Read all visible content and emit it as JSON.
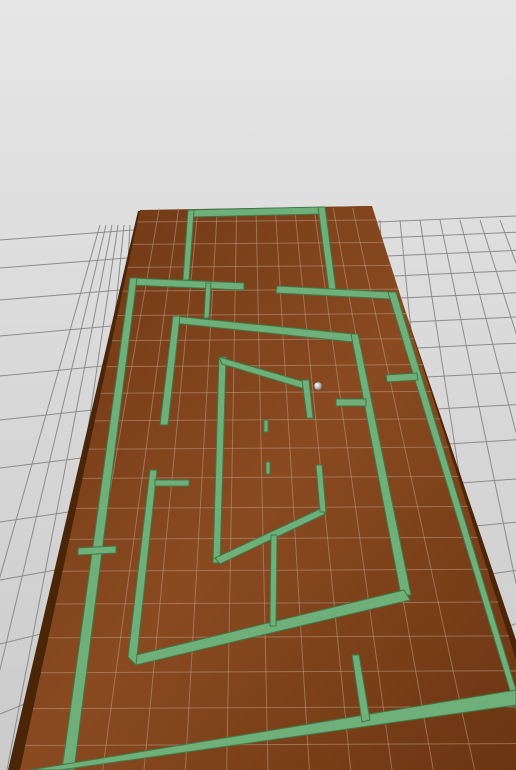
{
  "game": {
    "type": "3d-maze-tilt",
    "view": "perspective",
    "sky_color_top": "#e6e6e6",
    "sky_color_bottom": "#cbcbcb",
    "ground_color": "#c9c9c9",
    "grid_color": "#8c8c8c",
    "board_color": "#7a3f1a",
    "board_edge_color": "#4a2508",
    "tile_line_color": "#b89a86",
    "wall_color": "#6fb07a",
    "wall_dark_color": "#3f7a4a",
    "ball_color": "#e8e8e8"
  },
  "objects": {
    "board": "board",
    "ball": "ball",
    "walls": "maze-walls",
    "floor_grid": "floor-grid"
  }
}
